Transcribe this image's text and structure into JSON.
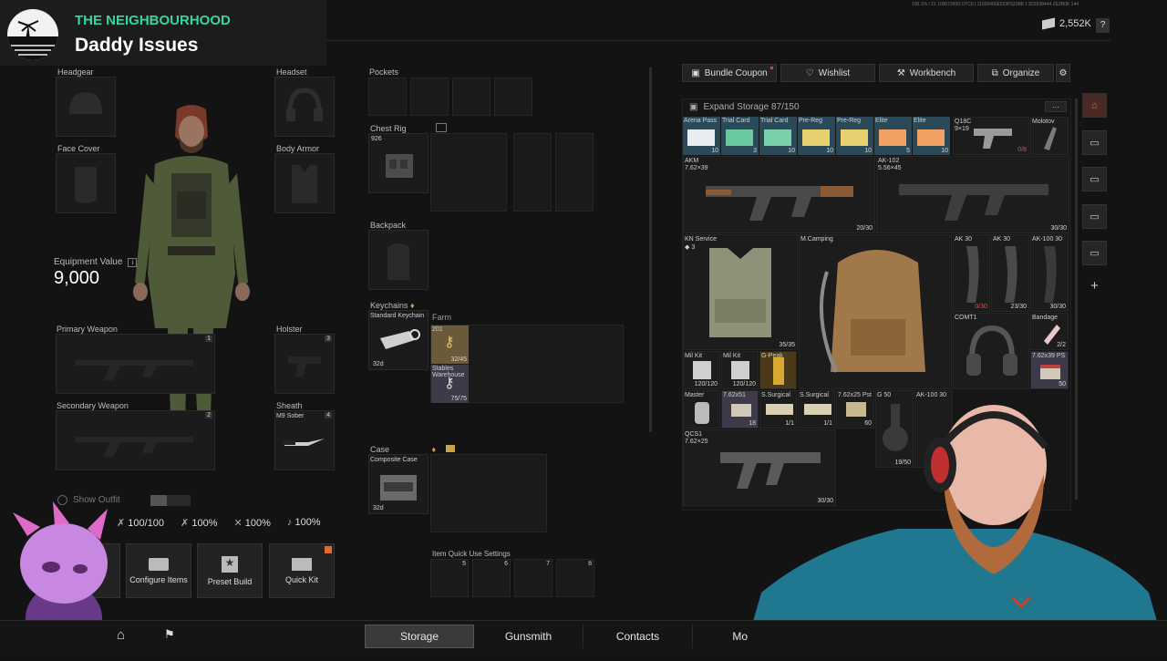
{
  "overlay": {
    "band": "THE NEIGHBOURHOOD",
    "song": "Daddy Issues"
  },
  "topbar": {
    "tiny_code": "100.1% / 21 100072500 UTC0 | 11506460E523F523B8 1 823538444 ZE2B0K 144",
    "currency": "2,552K",
    "help": "?"
  },
  "equipment": {
    "headgear": "Headgear",
    "headset": "Headset",
    "face_cover": "Face Cover",
    "body_armor": "Body Armor",
    "value_label": "Equipment Value",
    "value": "9,000",
    "primary": "Primary Weapon",
    "primary_num": "1",
    "holster": "Holster",
    "holster_num": "3",
    "secondary": "Secondary Weapon",
    "secondary_num": "2",
    "sheath": "Sheath",
    "sheath_item": "M9 Sober",
    "sheath_num": "4",
    "show_outfit": "Show Outfit"
  },
  "stats": {
    "health": "100/100",
    "s1": "100%",
    "s2": "100%",
    "s3": "100%"
  },
  "quick_buttons": {
    "configure": "Configure Items",
    "preset": "Preset Build",
    "quickkit": "Quick Kit"
  },
  "gear": {
    "pockets": "Pockets",
    "chest_rig": "Chest Rig",
    "rig_sub": "926",
    "backpack": "Backpack",
    "keychains": "Keychains",
    "keychain_name": "Standard Keychain",
    "keychain_time": "32d",
    "farm": "Farm",
    "key1_code": "201",
    "key1_count": "32/45",
    "key2_name": "Stables Warehouse",
    "key2_count": "75/75",
    "case": "Case",
    "case_name": "Composite Case",
    "case_time": "32d",
    "quick_use": "Item Quick Use Settings",
    "q5": "5",
    "q6": "6",
    "q7": "7",
    "q8": "8"
  },
  "stash_tabs": {
    "bundle": "Bundle Coupon",
    "wishlist": "Wishlist",
    "workbench": "Workbench",
    "organize": "Organize"
  },
  "storage": {
    "header": "Expand Storage  87/150",
    "items": {
      "arena_pass": "Arena Pass",
      "arena_pass_n": "10",
      "trial1": "Trial Card",
      "trial1_n": "3",
      "trial2": "Trial Card",
      "trial2_n": "10",
      "prereg1": "Pre-Reg",
      "prereg1_n": "10",
      "prereg2": "Pre-Reg",
      "prereg2_n": "10",
      "elite1": "Elite",
      "elite1_n": "5",
      "elite2": "Elite",
      "elite2_n": "10",
      "q18c": "Q18C",
      "q18c_cal": "9×19",
      "q18c_n": "0/8",
      "molotov": "Molotov",
      "akm": "AKM",
      "akm_cal": "7.62×39",
      "akm_n": "20/30",
      "ak102": "AK-102",
      "ak102_cal": "5.56×45",
      "ak102_n": "30/30",
      "knservice": "KN Service",
      "knservice_lvl": "3",
      "knservice_n": "35/35",
      "mcamping": "M.Camping",
      "ak30a": "AK 30",
      "ak30a_n": "0/30",
      "ak30b": "AK 30",
      "ak30b_n": "23/30",
      "ak100": "AK-100 30",
      "ak100_n": "30/30",
      "comt": "COMT1",
      "bandage": "Bandage",
      "bandage_n": "2/2",
      "ps762": "7.62x39 PS",
      "ps762_n": "50",
      "milkit1": "Mil Kit",
      "milkit1_n": "120/120",
      "milkit2": "Mil Kit",
      "milkit2_n": "120/120",
      "gpeak": "G-Peak",
      "master": "Master",
      "r762": "7.62x51",
      "r762_n": "18",
      "surg1": "S.Surgical",
      "surg1_n": "1/1",
      "surg2": "S.Surgical",
      "surg2_n": "1/1",
      "pst": "7.62x25 Pst",
      "pst_n": "60",
      "g50": "G 50",
      "g50_n": "19/50",
      "ak100b": "AK-100 30",
      "qcs1": "QCS1",
      "qcs1_cal": "7.62×25",
      "qcs1_n": "30/30"
    }
  },
  "bottom_nav": {
    "storage": "Storage",
    "gunsmith": "Gunsmith",
    "contacts": "Contacts",
    "more": "Mo"
  },
  "colors": {
    "accent": "#c8a24a",
    "card_blue": "#2a4a5a",
    "bg": "#131313"
  }
}
